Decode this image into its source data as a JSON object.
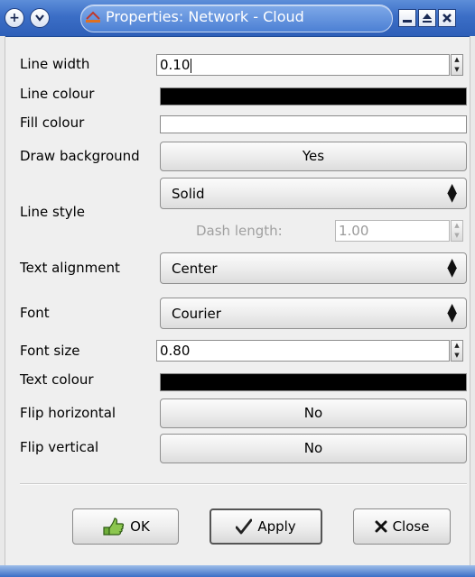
{
  "window": {
    "title": "Properties: Network - Cloud",
    "buttons": [
      "plus-icon",
      "chevron-down-icon",
      "minimize-icon",
      "maximize-icon",
      "close-icon"
    ]
  },
  "fields": {
    "line_width": {
      "label": "Line width",
      "value": "0.10"
    },
    "line_colour": {
      "label": "Line colour",
      "color": "#000000"
    },
    "fill_colour": {
      "label": "Fill colour",
      "color": "#ffffff"
    },
    "draw_background": {
      "label": "Draw background",
      "value": "Yes"
    },
    "line_style": {
      "label": "Line style",
      "value": "Solid",
      "dash_label": "Dash length:",
      "dash_value": "1.00"
    },
    "text_alignment": {
      "label": "Text alignment",
      "value": "Center"
    },
    "font": {
      "label": "Font",
      "value": "Courier"
    },
    "font_size": {
      "label": "Font size",
      "value": "0.80"
    },
    "text_colour": {
      "label": "Text colour",
      "color": "#000000"
    },
    "flip_horizontal": {
      "label": "Flip horizontal",
      "value": "No"
    },
    "flip_vertical": {
      "label": "Flip vertical",
      "value": "No"
    }
  },
  "actions": {
    "ok": "OK",
    "apply": "Apply",
    "close": "Close"
  },
  "colors": {
    "titlebar": "#3b6ec6",
    "background": "#efefef"
  }
}
